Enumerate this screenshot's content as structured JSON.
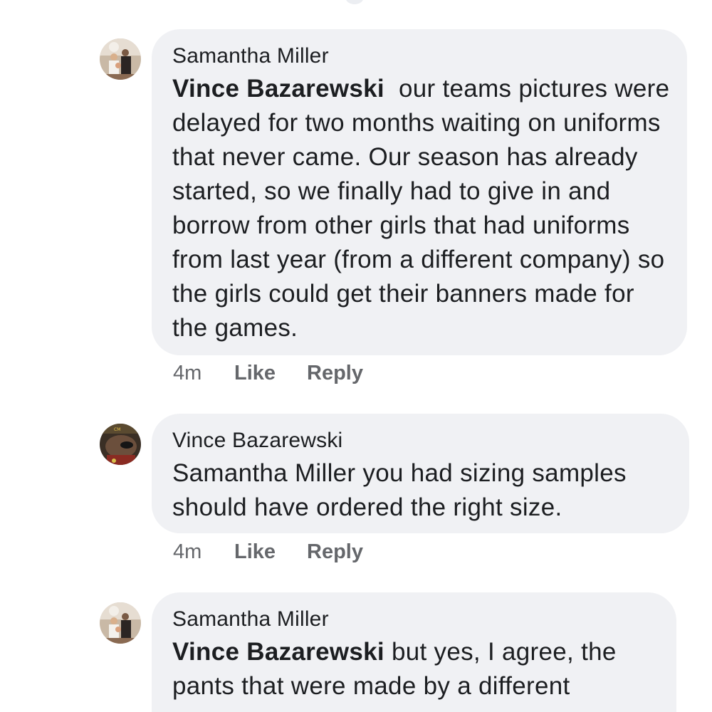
{
  "comments": [
    {
      "author": "Samantha Miller",
      "mention": "Vince Bazarewski",
      "body": "  our teams pictures were delayed for two months waiting on uniforms that never came. Our season has already started, so we finally had to give in and borrow from other girls that had uniforms from last year (from a different company) so the girls could get their banners made for the games.",
      "time": "4m",
      "like_label": "Like",
      "reply_label": "Reply",
      "avatar_icon": "family-photo-avatar"
    },
    {
      "author": "Vince Bazarewski",
      "mention": "",
      "body": "Samantha Miller you had sizing samples should have ordered the right size.",
      "time": "4m",
      "like_label": "Like",
      "reply_label": "Reply",
      "avatar_icon": "dark-photo-avatar"
    },
    {
      "author": "Samantha Miller",
      "mention": "Vince Bazarewski",
      "body": " but yes, I agree, the pants that were made by a different",
      "time": "",
      "like_label": "",
      "reply_label": "",
      "avatar_icon": "family-photo-avatar"
    }
  ],
  "colors": {
    "bubble_bg": "#f0f1f4",
    "text": "#1c1e21",
    "meta": "#65676b"
  }
}
